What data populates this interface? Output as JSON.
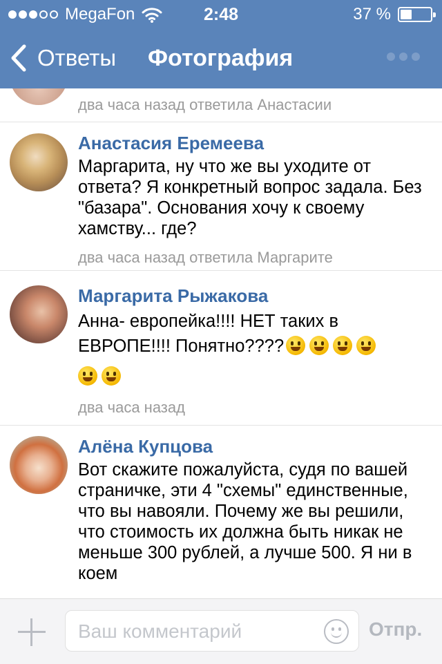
{
  "status_bar": {
    "carrier": "MegaFon",
    "time": "2:48",
    "battery": "37 %",
    "battery_level": 0.37,
    "signal_bars": 3
  },
  "nav": {
    "back_label": "Ответы",
    "title": "Фотография"
  },
  "comments": [
    {
      "meta": "два часа назад ответила Анастасии"
    },
    {
      "author": "Анастасия Еремеева",
      "text": "Маргарита, ну что же вы уходите от ответа? Я конкретный вопрос задала. Без \"базара\". Основания хочу к своему хамству... где?",
      "meta": "два часа назад ответила Маргарите"
    },
    {
      "author": "Маргарита Рыжакова",
      "text_line1": "Анна- европейка!!!! НЕТ таких в",
      "text_line2": "ЕВРОПЕ!!!! Понятно????",
      "meta": "два часа назад"
    },
    {
      "author": "Алёна Купцова",
      "text": "Вот скажите пожалуйста, судя по вашей страничке, эти 4 \"схемы\" единственные, что вы навояли. Почему же вы решили, что стоимость их должна быть никак не меньше 300 рублей, а лучше 500. Я ни в коем"
    }
  ],
  "input_bar": {
    "placeholder": "Ваш комментарий",
    "send_label": "Отпр."
  },
  "icons": {
    "back": "chevron-left-icon",
    "more": "more-dots-icon",
    "attach": "plus-icon",
    "emoji": "smiley-icon"
  },
  "colors": {
    "header": "#5a84ba",
    "author": "#3a6aa6",
    "meta": "#9a9a9a"
  }
}
